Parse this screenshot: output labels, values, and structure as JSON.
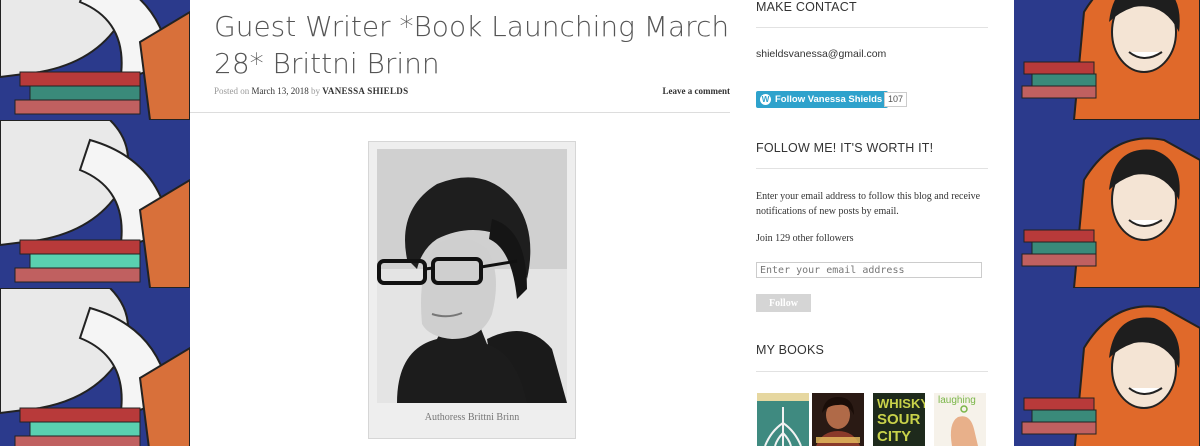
{
  "post": {
    "title": "Guest Writer *Book Launching March 28* Brittni Brinn",
    "posted_on_label": "Posted on",
    "date": "March 13, 2018",
    "by_label": "by",
    "author": "VANESSA SHIELDS",
    "leave_comment": "Leave a comment",
    "image_caption": "Authoress Brittni Brinn"
  },
  "sidebar": {
    "contact": {
      "title": "MAKE CONTACT",
      "email": "shieldsvanessa@gmail.com",
      "follow_button": "Follow Vanessa Shields",
      "follow_count": "107"
    },
    "subscribe": {
      "title": "FOLLOW ME! IT'S WORTH IT!",
      "description": "Enter your email address to follow this blog and receive notifications of new posts by email.",
      "followers": "Join 129 other followers",
      "email_placeholder": "Enter your email address",
      "submit": "Follow"
    },
    "books": {
      "title": "MY BOOKS",
      "covers": [
        {
          "icon": "book-cover-tree-roots"
        },
        {
          "icon": "book-cover-portrait"
        },
        {
          "icon": "book-cover-whisky-sour-city",
          "text_1": "WHISKY",
          "text_2": "SOUR",
          "text_3": "CITY"
        },
        {
          "icon": "book-cover-laughing",
          "text_1": "laughing"
        }
      ]
    }
  },
  "colors": {
    "follow_blue": "#2ea2cc",
    "title_gray": "#555555"
  }
}
